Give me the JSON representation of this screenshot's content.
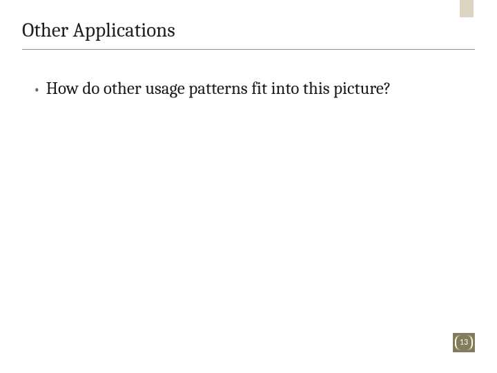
{
  "slide": {
    "title": "Other Applications",
    "bullet": "How do other usage patterns fit into this picture?",
    "page_number": "13"
  }
}
